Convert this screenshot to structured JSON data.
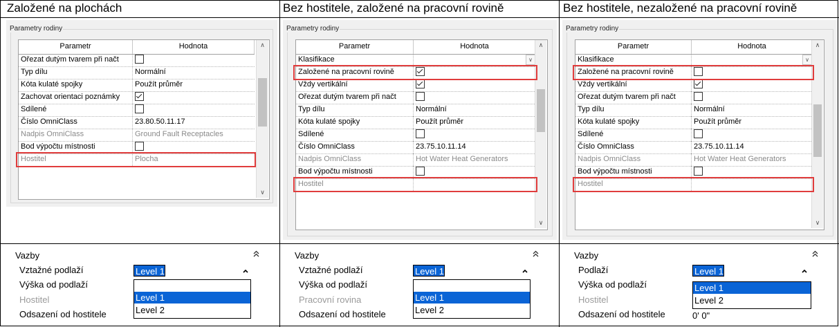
{
  "columns": [
    {
      "heading": "Založené na plochách",
      "panel_label": "Parametry rodiny",
      "header": {
        "param": "Parametr",
        "value": "Hodnota"
      },
      "rows": [
        {
          "param": "Ořezat dutým tvarem při načt",
          "value": "",
          "checkbox": false,
          "dim": false
        },
        {
          "param": "Typ dílu",
          "value": "Normální",
          "dim": false
        },
        {
          "param": "Kóta kulaté spojky",
          "value": "Použít průměr",
          "dim": false
        },
        {
          "param": "Zachovat orientaci poznámky",
          "value": "",
          "checkbox": true,
          "dim": false
        },
        {
          "param": "Sdílené",
          "value": "",
          "checkbox": false,
          "dim": false
        },
        {
          "param": "Číslo OmniClass",
          "value": "23.80.50.11.17",
          "dim": false
        },
        {
          "param": "Nadpis OmniClass",
          "value": "Ground Fault Receptacles",
          "dim": true
        },
        {
          "param": "Bod výpočtu místnosti",
          "value": "",
          "checkbox": false,
          "dim": false
        },
        {
          "param": "Hostitel",
          "value": "Plocha",
          "dim": true
        }
      ],
      "vazby": {
        "title": "Vazby",
        "labels": [
          "Vztažné podlaží",
          "Výška od podlaží",
          "Hostitel",
          "Odsazení od hostitele"
        ],
        "selected": "Level 1",
        "options": [
          "Level 1",
          "Level 2"
        ]
      }
    },
    {
      "heading": "Bez hostitele, založené na pracovní rovině",
      "panel_label": "Parametry rodiny",
      "header": {
        "param": "Parametr",
        "value": "Hodnota"
      },
      "rows": [
        {
          "param": "Klasifikace",
          "value": "",
          "dropdown": true,
          "dim": false
        },
        {
          "param": "Založené na pracovní rovině",
          "value": "",
          "checkbox": true,
          "dim": false
        },
        {
          "param": "Vždy vertikální",
          "value": "",
          "checkbox": true,
          "dim": false
        },
        {
          "param": "Ořezat dutým tvarem při načt",
          "value": "",
          "checkbox": false,
          "dim": false
        },
        {
          "param": "Typ dílu",
          "value": "Normální",
          "dim": false
        },
        {
          "param": "Kóta kulaté spojky",
          "value": "Použít průměr",
          "dim": false
        },
        {
          "param": "Sdílené",
          "value": "",
          "checkbox": false,
          "dim": false
        },
        {
          "param": "Číslo OmniClass",
          "value": "23.75.10.11.14",
          "dim": false
        },
        {
          "param": "Nadpis OmniClass",
          "value": "Hot Water Heat Generators",
          "dim": true
        },
        {
          "param": "Bod výpočtu místnosti",
          "value": "",
          "checkbox": false,
          "dim": false
        },
        {
          "param": "Hostitel",
          "value": "",
          "dim": true
        }
      ],
      "vazby": {
        "title": "Vazby",
        "labels": [
          "Vztažné podlaží",
          "Výška od podlaží",
          "Pracovní rovina",
          "Odsazení od hostitele"
        ],
        "selected": "Level 1",
        "options": [
          "Level 1",
          "Level 2"
        ]
      }
    },
    {
      "heading": "Bez hostitele, nezaložené na pracovní rovině",
      "panel_label": "Parametry rodiny",
      "header": {
        "param": "Parametr",
        "value": "Hodnota"
      },
      "rows": [
        {
          "param": "Klasifikace",
          "value": "",
          "dropdown": true,
          "dim": false
        },
        {
          "param": "Založené na pracovní rovině",
          "value": "",
          "checkbox": false,
          "dim": false
        },
        {
          "param": "Vždy vertikální",
          "value": "",
          "checkbox": true,
          "dim": false
        },
        {
          "param": "Ořezat dutým tvarem při načt",
          "value": "",
          "checkbox": false,
          "dim": false
        },
        {
          "param": "Typ dílu",
          "value": "Normální",
          "dim": false
        },
        {
          "param": "Kóta kulaté spojky",
          "value": "Použít průměr",
          "dim": false
        },
        {
          "param": "Sdílené",
          "value": "",
          "checkbox": false,
          "dim": false
        },
        {
          "param": "Číslo OmniClass",
          "value": "23.75.10.11.14",
          "dim": false
        },
        {
          "param": "Nadpis OmniClass",
          "value": "Hot Water Heat Generators",
          "dim": true
        },
        {
          "param": "Bod výpočtu místnosti",
          "value": "",
          "checkbox": false,
          "dim": false
        },
        {
          "param": "Hostitel",
          "value": "",
          "dim": true
        }
      ],
      "vazby": {
        "title": "Vazby",
        "labels": [
          "Podlaží",
          "Výška od podlaží",
          "Hostitel",
          "Odsazení od hostitele"
        ],
        "selected": "Level 1",
        "options": [
          "Level 1",
          "Level 2"
        ],
        "offset_value": "0'  0\""
      }
    }
  ],
  "colors": {
    "highlight": "#e03c3c",
    "selection": "#0a64d6",
    "panel_bg": "#f0f0f0"
  }
}
